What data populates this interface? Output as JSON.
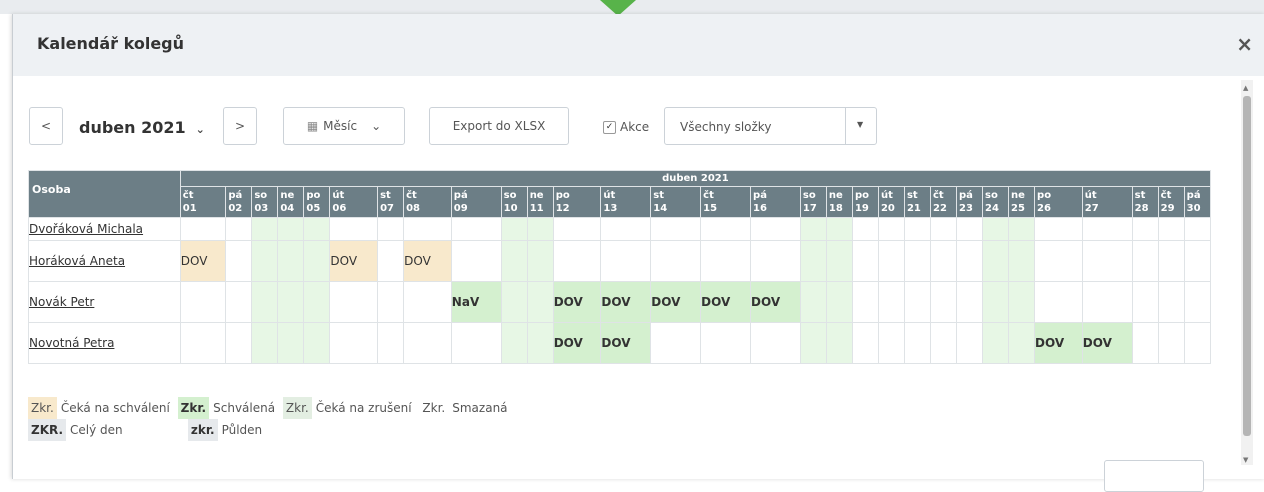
{
  "window": {
    "title": "Kalendář kolegů",
    "close_glyph": "×"
  },
  "toolbar": {
    "prev_label": "<",
    "next_label": ">",
    "month_label": "duben 2021",
    "month_chevron": "⌄",
    "view_icon": "▦",
    "view_label": "Měsíc",
    "view_chevron": "⌄",
    "export_label": "Export do XLSX",
    "akce_checked": "✓",
    "akce_label": "Akce",
    "folder_select": "Všechny složky",
    "folder_caret": "▼"
  },
  "table": {
    "person_header": "Osoba",
    "month_header": "duben 2021",
    "days": [
      {
        "d": "čt",
        "n": "01",
        "w": false
      },
      {
        "d": "pá",
        "n": "02",
        "w": false
      },
      {
        "d": "so",
        "n": "03",
        "w": true
      },
      {
        "d": "ne",
        "n": "04",
        "w": true
      },
      {
        "d": "po",
        "n": "05",
        "w": true
      },
      {
        "d": "út",
        "n": "06",
        "w": false
      },
      {
        "d": "st",
        "n": "07",
        "w": false
      },
      {
        "d": "čt",
        "n": "08",
        "w": false
      },
      {
        "d": "pá",
        "n": "09",
        "w": false
      },
      {
        "d": "so",
        "n": "10",
        "w": true
      },
      {
        "d": "ne",
        "n": "11",
        "w": true
      },
      {
        "d": "po",
        "n": "12",
        "w": false
      },
      {
        "d": "út",
        "n": "13",
        "w": false
      },
      {
        "d": "st",
        "n": "14",
        "w": false
      },
      {
        "d": "čt",
        "n": "15",
        "w": false
      },
      {
        "d": "pá",
        "n": "16",
        "w": false
      },
      {
        "d": "so",
        "n": "17",
        "w": true
      },
      {
        "d": "ne",
        "n": "18",
        "w": true
      },
      {
        "d": "po",
        "n": "19",
        "w": false
      },
      {
        "d": "út",
        "n": "20",
        "w": false
      },
      {
        "d": "st",
        "n": "21",
        "w": false
      },
      {
        "d": "čt",
        "n": "22",
        "w": false
      },
      {
        "d": "pá",
        "n": "23",
        "w": false
      },
      {
        "d": "so",
        "n": "24",
        "w": true
      },
      {
        "d": "ne",
        "n": "25",
        "w": true
      },
      {
        "d": "po",
        "n": "26",
        "w": false
      },
      {
        "d": "út",
        "n": "27",
        "w": false
      },
      {
        "d": "st",
        "n": "28",
        "w": false
      },
      {
        "d": "čt",
        "n": "29",
        "w": false
      },
      {
        "d": "pá",
        "n": "30",
        "w": false
      }
    ],
    "rows": [
      {
        "name": "Dvořáková Michala",
        "entries": []
      },
      {
        "name": "Horáková Aneta",
        "entries": [
          {
            "day": 1,
            "label": "DOV",
            "status": "waiting"
          },
          {
            "day": 6,
            "label": "DOV",
            "status": "waiting"
          },
          {
            "day": 8,
            "label": "DOV",
            "status": "waiting"
          }
        ]
      },
      {
        "name": "Novák Petr",
        "entries": [
          {
            "day": 9,
            "label": "NaV",
            "status": "approved"
          },
          {
            "day": 12,
            "label": "DOV",
            "status": "approved"
          },
          {
            "day": 13,
            "label": "DOV",
            "status": "approved"
          },
          {
            "day": 14,
            "label": "DOV",
            "status": "approved"
          },
          {
            "day": 15,
            "label": "DOV",
            "status": "approved"
          },
          {
            "day": 16,
            "label": "DOV",
            "status": "approved"
          }
        ]
      },
      {
        "name": "Novotná Petra",
        "entries": [
          {
            "day": 12,
            "label": "DOV",
            "status": "approved"
          },
          {
            "day": 13,
            "label": "DOV",
            "status": "approved"
          },
          {
            "day": 26,
            "label": "DOV",
            "status": "approved"
          },
          {
            "day": 27,
            "label": "DOV",
            "status": "approved"
          }
        ]
      }
    ]
  },
  "legend": {
    "waiting_abbr": "Zkr.",
    "waiting_text": "Čeká na schválení",
    "approved_abbr": "Zkr.",
    "approved_text": "Schválená",
    "cancel_abbr": "Zkr.",
    "cancel_text": "Čeká na zrušení",
    "deleted_abbr": "Zkr.",
    "deleted_text": "Smazaná",
    "fullday_abbr": "ZKR.",
    "fullday_text": "Celý den",
    "halfday_abbr": "zkr.",
    "halfday_text": "Půlden"
  },
  "colors": {
    "header_bg": "#6c7e86",
    "weekend": "#e7f7e5",
    "waiting": "#f8e9cc",
    "approved": "#d4f0cf",
    "accent_arrow": "#58b34a"
  }
}
